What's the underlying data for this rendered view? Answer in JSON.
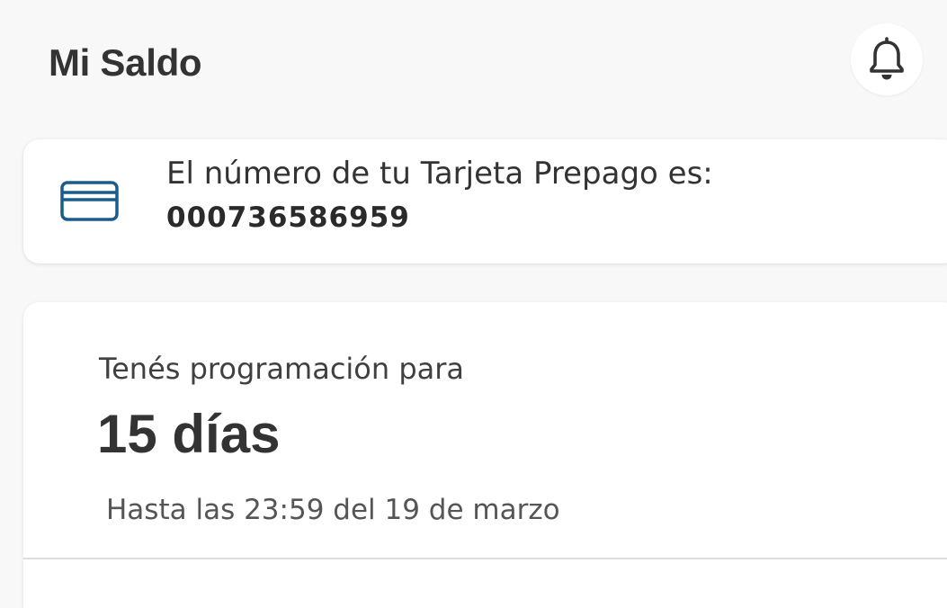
{
  "header": {
    "title": "Mi Saldo",
    "notifications_icon": "bell-icon"
  },
  "card_info": {
    "icon": "credit-card-icon",
    "label": "El número de tu Tarjeta Prepago es:",
    "number": "000736586959",
    "icon_color": "#1b5c8a"
  },
  "schedule": {
    "label": "Tenés programación para",
    "days": "15 días",
    "until": "Hasta las 23:59 del 19 de marzo"
  },
  "colors": {
    "background": "#f8f8f8",
    "card_background": "#ffffff",
    "text_primary": "#333333",
    "accent": "#1b5c8a"
  }
}
